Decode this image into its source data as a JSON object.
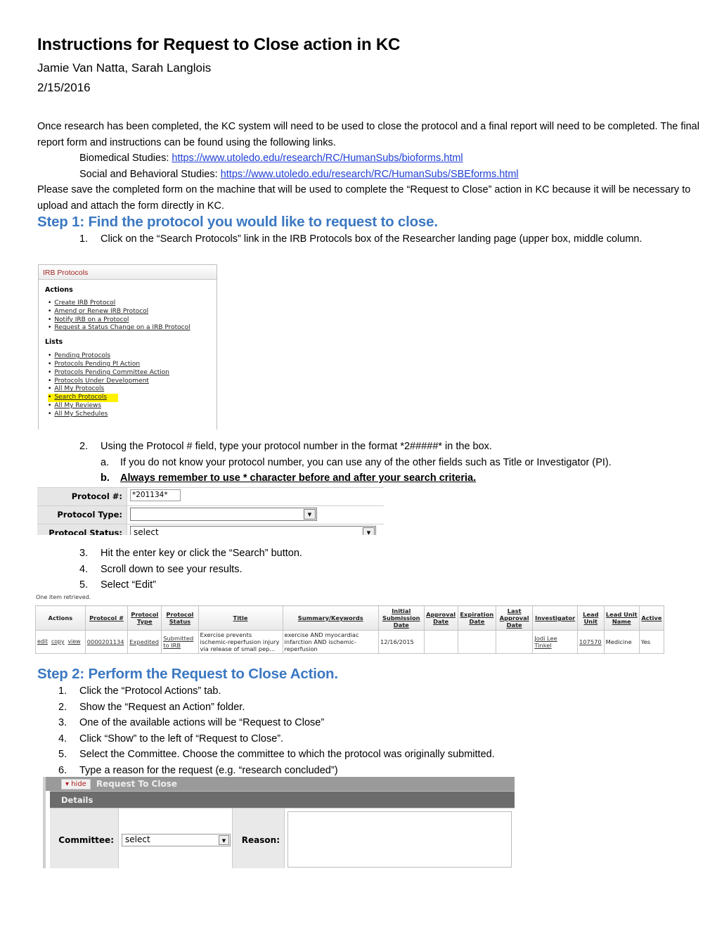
{
  "header": {
    "title": "Instructions for Request to Close action in KC",
    "authors": "Jamie Van Natta, Sarah Langlois",
    "date": "2/15/2016"
  },
  "intro": {
    "paragraph1": "Once research has been completed, the KC system will need to be used to close the protocol and a final report will need to be completed. The final report form and instructions can be found using the following links.",
    "links": [
      {
        "label": "Biomedical Studies: ",
        "url_text": "https://www.utoledo.edu/research/RC/HumanSubs/bioforms.html"
      },
      {
        "label": "Social and Behavioral Studies: ",
        "url_text": "https://www.utoledo.edu/research/RC/HumanSubs/SBEforms.html"
      }
    ],
    "paragraph2": "Please save the completed form on the machine that will be used to complete the “Request to Close” action in KC because it will be necessary to upload and attach the form directly in KC."
  },
  "step1": {
    "heading": "Step 1: Find the protocol you would like to request to close.",
    "items": [
      {
        "num": "1.",
        "text": "Click on the “Search Protocols” link in the IRB Protocols box of the Researcher landing page (upper box, middle column."
      },
      {
        "num": "2.",
        "text": "Using the Protocol # field, type your protocol number in the format *2#####* in the box."
      },
      {
        "num": "3.",
        "text": "Hit the enter key or click the “Search” button."
      },
      {
        "num": "4.",
        "text": "Scroll down to see your results."
      },
      {
        "num": "5.",
        "text": "Select “Edit”"
      }
    ],
    "subitems": [
      {
        "num": "a.",
        "text": "If you do not know your protocol number, you can use any of the other fields such as Title or Investigator (PI)."
      },
      {
        "num": "b.",
        "text": "Always remember to use * character before and after your search criteria."
      }
    ]
  },
  "irb_box": {
    "title": "IRB Protocols",
    "actions_heading": "Actions",
    "actions": [
      "Create IRB Protocol",
      "Amend or Renew IRB Protocol",
      "Notify IRB on a Protocol",
      "Request a Status Change on a IRB Protocol"
    ],
    "lists_heading": "Lists",
    "lists": [
      "Pending Protocols",
      "Protocols Pending PI Action",
      "Protocols Pending Committee Action",
      "Protocols Under Development",
      "All My Protocols",
      "Search Protocols",
      "All My Reviews",
      "All My Schedules"
    ],
    "highlighted": "Search Protocols",
    "highlight_color": "#fff200",
    "title_color": "#a02622"
  },
  "search_form": {
    "protocol_number_label": "Protocol #:",
    "protocol_number_value": "*201134*",
    "protocol_type_label": "Protocol Type:",
    "protocol_type_value": "",
    "protocol_status_label": "Protocol Status:",
    "protocol_status_value": "select"
  },
  "results": {
    "status": "One item retrieved.",
    "columns": [
      "Actions",
      "Protocol #",
      "Protocol Type",
      "Protocol Status",
      "Title",
      "Summary/Keywords",
      "Initial Submission Date",
      "Approval Date",
      "Expiration Date",
      "Last Approval Date",
      "Investigator",
      "Lead Unit",
      "Lead Unit Name",
      "Active"
    ],
    "rows": [
      {
        "actions": [
          "edit",
          "copy",
          "view"
        ],
        "protocol_number": "0000201134",
        "protocol_type": "Expedited",
        "protocol_status": "Submitted to IRB",
        "title": "Exercise prevents ischemic-reperfusion injury via release of small pep...",
        "summary": "exercise AND myocardiac infarction AND ischemic-reperfusion",
        "initial_submission_date": "12/16/2015",
        "approval_date": "",
        "expiration_date": "",
        "last_approval_date": "",
        "investigator": "Jodi Lee Tinkel",
        "lead_unit": "107570",
        "lead_unit_name": "Medicine",
        "active": "Yes"
      }
    ]
  },
  "step2": {
    "heading": "Step 2: Perform the Request to Close Action.",
    "items": [
      {
        "num": "1.",
        "text": "Click the “Protocol Actions” tab."
      },
      {
        "num": "2.",
        "text": "Show the “Request an Action” folder."
      },
      {
        "num": "3.",
        "text": "One of the available actions will be “Request to Close”"
      },
      {
        "num": "4.",
        "text": "Click “Show” to the left of “Request to Close”."
      },
      {
        "num": "5.",
        "text": "Select the Committee.  Choose the committee to which the protocol was originally submitted."
      },
      {
        "num": "6.",
        "text": "Type a reason for the request (e.g.  “research concluded”)"
      }
    ]
  },
  "request_panel": {
    "hide_label": "▾ hide",
    "title": "Request To Close",
    "details_label": "Details",
    "committee_label": "Committee:",
    "committee_value": "select",
    "reason_label": "Reason:",
    "reason_value": ""
  },
  "colors": {
    "heading_blue": "#3b78c2",
    "link_blue": "#1f3fd6"
  }
}
